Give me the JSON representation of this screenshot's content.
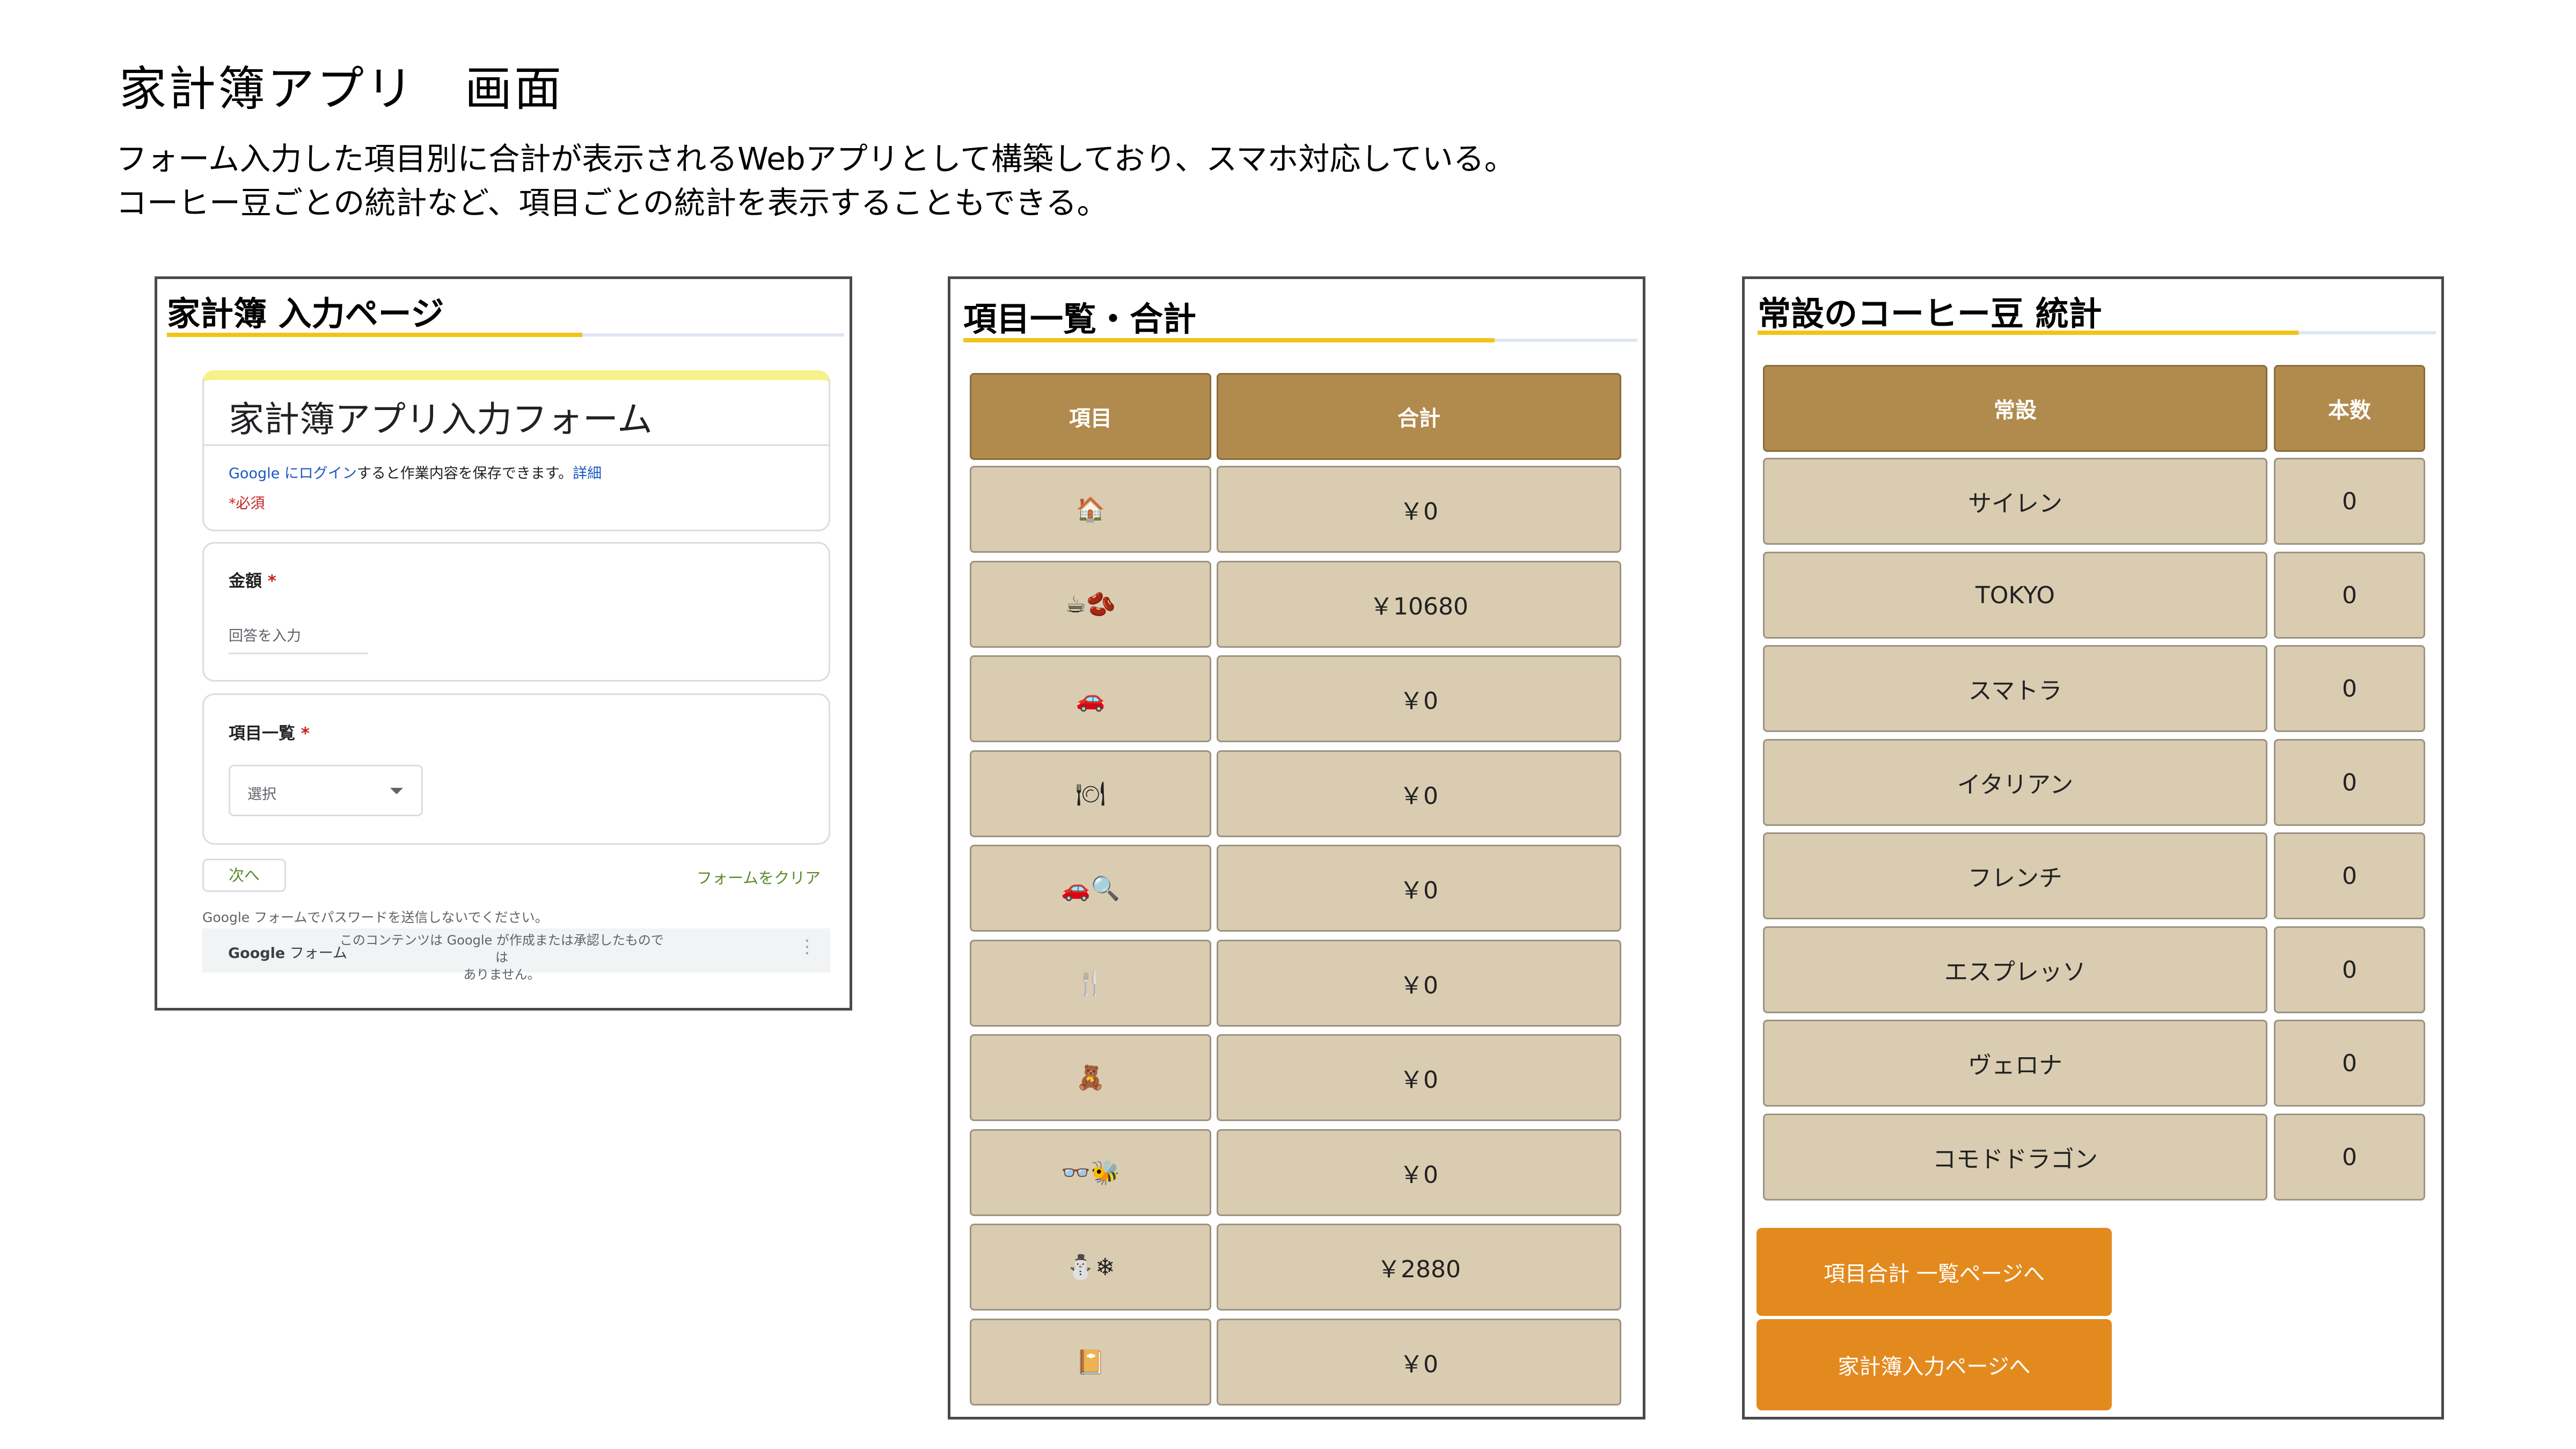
{
  "page": {
    "title": "家計簿アプリ　画面",
    "description": [
      "フォーム入力した項目別に合計が表示されるWebアプリとして構築しており、スマホ対応している。",
      "コーヒー豆ごとの統計など、項目ごとの統計を表示することもできる。"
    ]
  },
  "input_page": {
    "heading": "家計簿 入力ページ",
    "form_title": "家計簿アプリ入力フォーム",
    "login_google": "Google",
    "login_link": "にログイン",
    "login_rest": "すると作業内容を保存できます。",
    "login_detail": "詳細",
    "required_note": "*必須",
    "amount_label": "金額",
    "amount_placeholder": "回答を入力",
    "category_label": "項目一覧",
    "select_placeholder": "選択",
    "next_button": "次へ",
    "clear_button": "フォームをクリア",
    "password_note": "Google フォームでパスワードを送信しないでください。",
    "footer_brand": "Google",
    "footer_brand_suffix": "フォーム",
    "disclaimer_line1": "このコンテンツは Google が作成または承認したものでは",
    "disclaimer_line2": "ありません。",
    "star": "*"
  },
  "summary_page": {
    "heading": "項目一覧・合計",
    "col_item": "項目",
    "col_total": "合計",
    "rows": [
      {
        "icon": "🏠",
        "icon_name": "house-icon",
        "total": "￥0"
      },
      {
        "icon": "☕🫘",
        "icon_name": "coffee-beans-icon",
        "total": "￥10680"
      },
      {
        "icon": "🚗",
        "icon_name": "car-icon",
        "total": "￥0"
      },
      {
        "icon": "🍽",
        "icon_name": "dining-icon",
        "total": "￥0"
      },
      {
        "icon": "🚗🔍",
        "icon_name": "car-search-icon",
        "total": "￥0"
      },
      {
        "icon": "🍴",
        "icon_name": "fork-knife-icon",
        "total": "￥0"
      },
      {
        "icon": "🧸",
        "icon_name": "teddy-bear-icon",
        "total": "￥0"
      },
      {
        "icon": "👓🐝",
        "icon_name": "glasses-bee-icon",
        "total": "￥0"
      },
      {
        "icon": "⛄❄",
        "icon_name": "snowman-icon",
        "total": "￥2880"
      },
      {
        "icon": "📔",
        "icon_name": "notebook-icon",
        "total": "￥0"
      }
    ]
  },
  "coffee_page": {
    "heading": "常設のコーヒー豆 統計",
    "col_name": "常設",
    "col_count": "本数",
    "rows": [
      {
        "name": "サイレン",
        "count": "0"
      },
      {
        "name": "TOKYO",
        "count": "0"
      },
      {
        "name": "スマトラ",
        "count": "0"
      },
      {
        "name": "イタリアン",
        "count": "0"
      },
      {
        "name": "フレンチ",
        "count": "0"
      },
      {
        "name": "エスプレッソ",
        "count": "0"
      },
      {
        "name": "ヴェロナ",
        "count": "0"
      },
      {
        "name": "コモドドラゴン",
        "count": "0"
      }
    ],
    "btn_summary": "項目合計 一覧ページへ",
    "btn_input": "家計簿入力ページへ"
  }
}
